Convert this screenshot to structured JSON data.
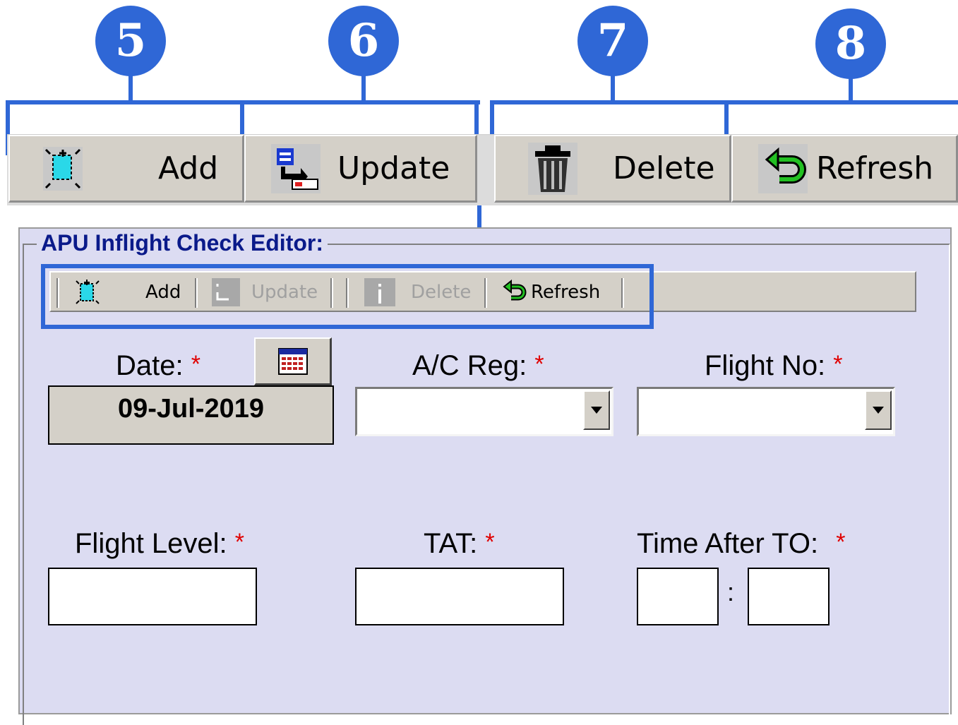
{
  "callouts": [
    "5",
    "6",
    "7",
    "8"
  ],
  "toolbar_main": {
    "add_label": "Add",
    "update_label": "Update",
    "delete_label": "Delete",
    "refresh_label": "Refresh"
  },
  "editor": {
    "title": "APU Inflight Check Editor:",
    "toolbar": {
      "add_label": "Add",
      "update_label": "Update",
      "delete_label": "Delete",
      "refresh_label": "Refresh"
    },
    "fields": {
      "date_label": "Date:",
      "date_value": "09-Jul-2019",
      "ac_reg_label": "A/C Reg:",
      "ac_reg_value": "",
      "flight_no_label": "Flight No:",
      "flight_no_value": "",
      "flight_level_label": "Flight Level:",
      "flight_level_value": "",
      "tat_label": "TAT:",
      "tat_value": "",
      "time_after_to_label": "Time After TO:",
      "time_after_to_hours": "",
      "time_after_to_minutes": "",
      "time_separator": ":",
      "required_marker": "*"
    }
  },
  "colors": {
    "callout_blue": "#2f67d6",
    "panel_bg": "#dcdcf2",
    "title_text": "#0a1a8a",
    "required_red": "#e00000"
  }
}
